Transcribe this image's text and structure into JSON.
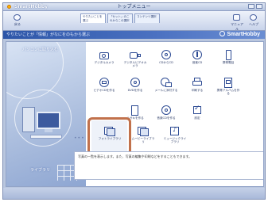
{
  "app": {
    "name": "SmartHobby",
    "window_title": "トップメニュー"
  },
  "toolbar": {
    "back_label": "戻る",
    "tabs": [
      {
        "label": "やりたいことを選ぶ"
      },
      {
        "label": "「セット」のこれからこの選択"
      },
      {
        "label": "コンテンツ選択"
      }
    ],
    "help_labels": [
      "マニュアル",
      "ヘルプ"
    ]
  },
  "hint": {
    "text": "やりたいことが「情報」がなにをのもから選ぶ"
  },
  "brand": {
    "text": "SmartHobby"
  },
  "art": {
    "label_top": "パソコンに取り込む",
    "label_bottom": "ライブラリ"
  },
  "tiles": [
    {
      "label": "デジタルカメラ"
    },
    {
      "label": "デジタルビデオカメラ"
    },
    {
      "label": "CDからCD"
    },
    {
      "label": "音楽CD"
    },
    {
      "label": "携帯電話"
    },
    {
      "label": "ビデオCDを作る"
    },
    {
      "label": "DVDを作る"
    },
    {
      "label": "メールに添付する"
    },
    {
      "label": "印刷する"
    },
    {
      "label": "携帯アルバムを作る"
    },
    {
      "label": "ハガキを作る"
    },
    {
      "label": "音楽CDを作る"
    },
    {
      "label": "設定"
    },
    {
      "label": "フォトライブラリ"
    },
    {
      "label": "ムービーライブラリ"
    },
    {
      "label": "ミュージックライブラリ"
    }
  ],
  "description": {
    "text": "写真の一覧を表示します。また、写真の編集や印刷などをすることもできます。"
  },
  "colors": {
    "accent": "#2d56a8",
    "highlight": "#c1714b",
    "background": "#b9c6de"
  }
}
